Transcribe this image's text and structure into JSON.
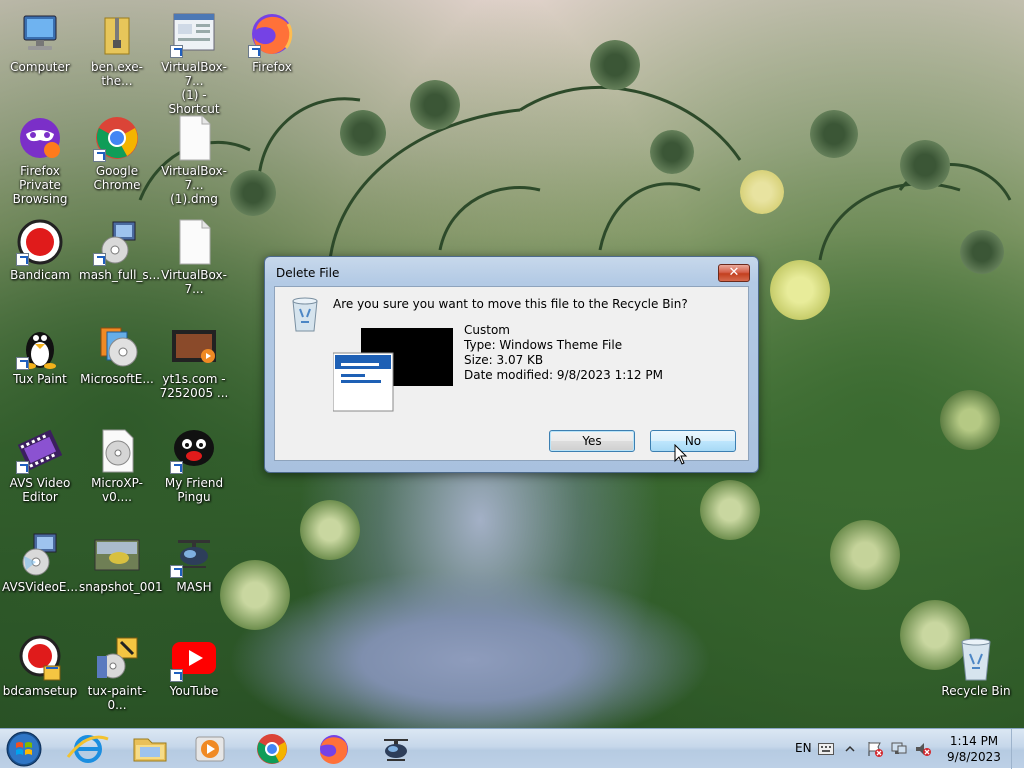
{
  "desktop": {
    "icons": [
      {
        "id": "computer",
        "label": "Computer"
      },
      {
        "id": "ben",
        "label": "ben.exe-the..."
      },
      {
        "id": "vbox_shortcut",
        "label": "VirtualBox-7...\n(1) - Shortcut"
      },
      {
        "id": "firefox",
        "label": "Firefox"
      },
      {
        "id": "firefox_private",
        "label": "Firefox Private\nBrowsing"
      },
      {
        "id": "chrome",
        "label": "Google\nChrome"
      },
      {
        "id": "vbox_dmg",
        "label": "VirtualBox-7...\n(1).dmg"
      },
      {
        "id": "bandicam",
        "label": "Bandicam"
      },
      {
        "id": "mash_full",
        "label": "mash_full_s..."
      },
      {
        "id": "vbox2",
        "label": "VirtualBox-7..."
      },
      {
        "id": "tuxpaint",
        "label": "Tux Paint"
      },
      {
        "id": "microsofte",
        "label": "MicrosoftE..."
      },
      {
        "id": "yt1s",
        "label": "yt1s.com -\n7252005 ..."
      },
      {
        "id": "avsvideo",
        "label": "AVS Video\nEditor"
      },
      {
        "id": "microxp",
        "label": "MicroXP-v0...."
      },
      {
        "id": "pingu",
        "label": "My Friend\nPingu"
      },
      {
        "id": "avsvideoe",
        "label": "AVSVideoE..."
      },
      {
        "id": "snapshot",
        "label": "snapshot_001"
      },
      {
        "id": "mash",
        "label": "MASH"
      },
      {
        "id": "bdcamsetup",
        "label": "bdcamsetup"
      },
      {
        "id": "tuxpaint_setup",
        "label": "tux-paint-0..."
      },
      {
        "id": "youtube",
        "label": "YouTube"
      },
      {
        "id": "recycle",
        "label": "Recycle Bin"
      }
    ]
  },
  "dialog": {
    "title": "Delete File",
    "close_glyph": "✕",
    "question": "Are you sure you want to move this file to the Recycle Bin?",
    "file": {
      "name": "Custom",
      "type": "Type: Windows Theme File",
      "size": "Size: 3.07 KB",
      "modified": "Date modified: 9/8/2023 1:12 PM"
    },
    "yes_label": "Yes",
    "no_label": "No"
  },
  "taskbar": {
    "pinned": [
      "internet-explorer",
      "windows-explorer",
      "media-player",
      "google-chrome",
      "firefox",
      "mash"
    ],
    "tray": {
      "language": "EN",
      "time": "1:14 PM",
      "date": "9/8/2023"
    }
  },
  "colors": {
    "dialog_frame": "#b3cae5",
    "close_button": "#c3401f",
    "taskbar": "#c6d7ea"
  }
}
